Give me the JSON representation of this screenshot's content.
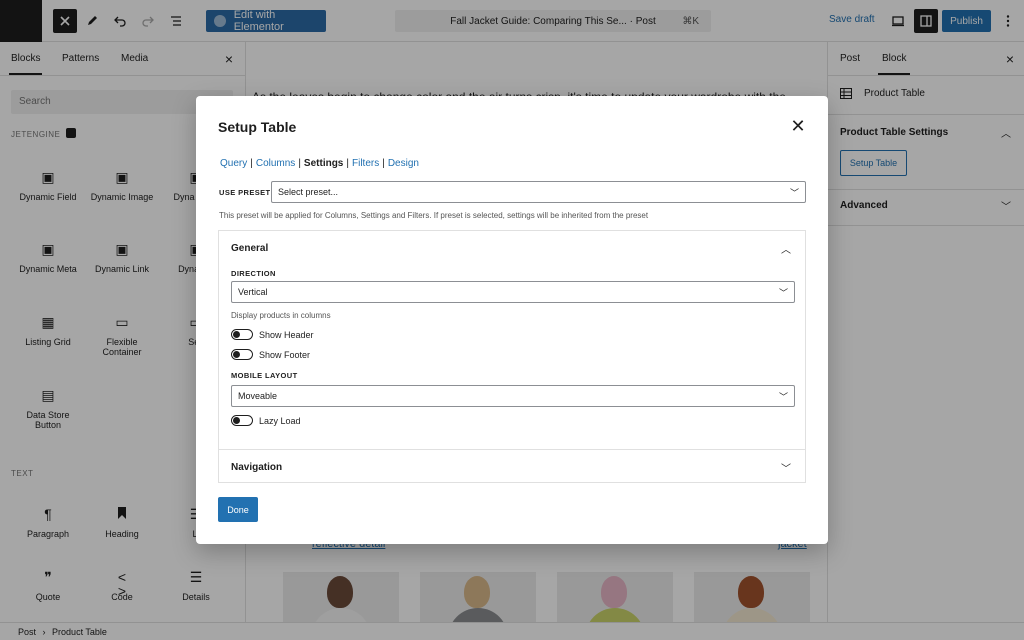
{
  "topbar": {
    "elementor_label": "Edit with Elementor",
    "doc_title": "Fall Jacket Guide: Comparing This Se... · Post",
    "shortcut": "⌘K",
    "save_draft": "Save draft",
    "publish": "Publish"
  },
  "left_sidebar": {
    "tabs": [
      "Blocks",
      "Patterns",
      "Media"
    ],
    "search_placeholder": "Search",
    "categories": {
      "jetengine": "JETENGINE",
      "text": "TEXT"
    },
    "jetengine_blocks": [
      {
        "label": "Dynamic Field",
        "icon": "dynamic-field-icon"
      },
      {
        "label": "Dynamic Image",
        "icon": "dynamic-image-icon"
      },
      {
        "label": "Dyna Repe",
        "icon": "dynamic-repeater-icon"
      },
      {
        "label": "Dynamic Meta",
        "icon": "dynamic-meta-icon"
      },
      {
        "label": "Dynamic Link",
        "icon": "dynamic-link-icon"
      },
      {
        "label": "Dyna Ter",
        "icon": "dynamic-terms-icon"
      },
      {
        "label": "Listing Grid",
        "icon": "listing-grid-icon"
      },
      {
        "label": "Flexible Container",
        "icon": "flexible-container-icon"
      },
      {
        "label": "Sec",
        "icon": "section-icon"
      },
      {
        "label": "Data Store Button",
        "icon": "data-store-icon"
      }
    ],
    "text_blocks": [
      {
        "label": "Paragraph",
        "icon": "paragraph-icon"
      },
      {
        "label": "Heading",
        "icon": "heading-icon"
      },
      {
        "label": "Li",
        "icon": "list-icon"
      },
      {
        "label": "Quote",
        "icon": "quote-icon"
      },
      {
        "label": "Code",
        "icon": "code-icon"
      },
      {
        "label": "Details",
        "icon": "details-icon"
      }
    ]
  },
  "canvas": {
    "intro_text": "As the leaves begin to change color and the air turns crisp, it's time to update your wardrobe with the",
    "link_left": "reflective detail",
    "link_right": "jacket"
  },
  "right_sidebar": {
    "tabs": [
      "Post",
      "Block"
    ],
    "block_name": "Product Table",
    "settings_title": "Product Table Settings",
    "setup_button": "Setup Table",
    "advanced": "Advanced"
  },
  "footer": {
    "crumb_post": "Post",
    "crumb_sep": "›",
    "crumb_block": "Product Table"
  },
  "modal": {
    "title": "Setup Table",
    "nav": {
      "query": "Query",
      "columns": "Columns",
      "settings": "Settings",
      "filters": "Filters",
      "design": "Design",
      "sep": "|"
    },
    "preset_label": "USE PRESET",
    "preset_value": "Select preset...",
    "preset_help": "This preset will be applied for Columns, Settings and Filters. If preset is selected, settings will be inherited from the preset",
    "general": {
      "title": "General",
      "direction_label": "DIRECTION",
      "direction_value": "Vertical",
      "direction_help": "Display products in columns",
      "show_header": "Show Header",
      "show_footer": "Show Footer",
      "mobile_layout_label": "MOBILE LAYOUT",
      "mobile_layout_value": "Moveable",
      "lazy_load": "Lazy Load"
    },
    "navigation": "Navigation",
    "done": "Done"
  }
}
